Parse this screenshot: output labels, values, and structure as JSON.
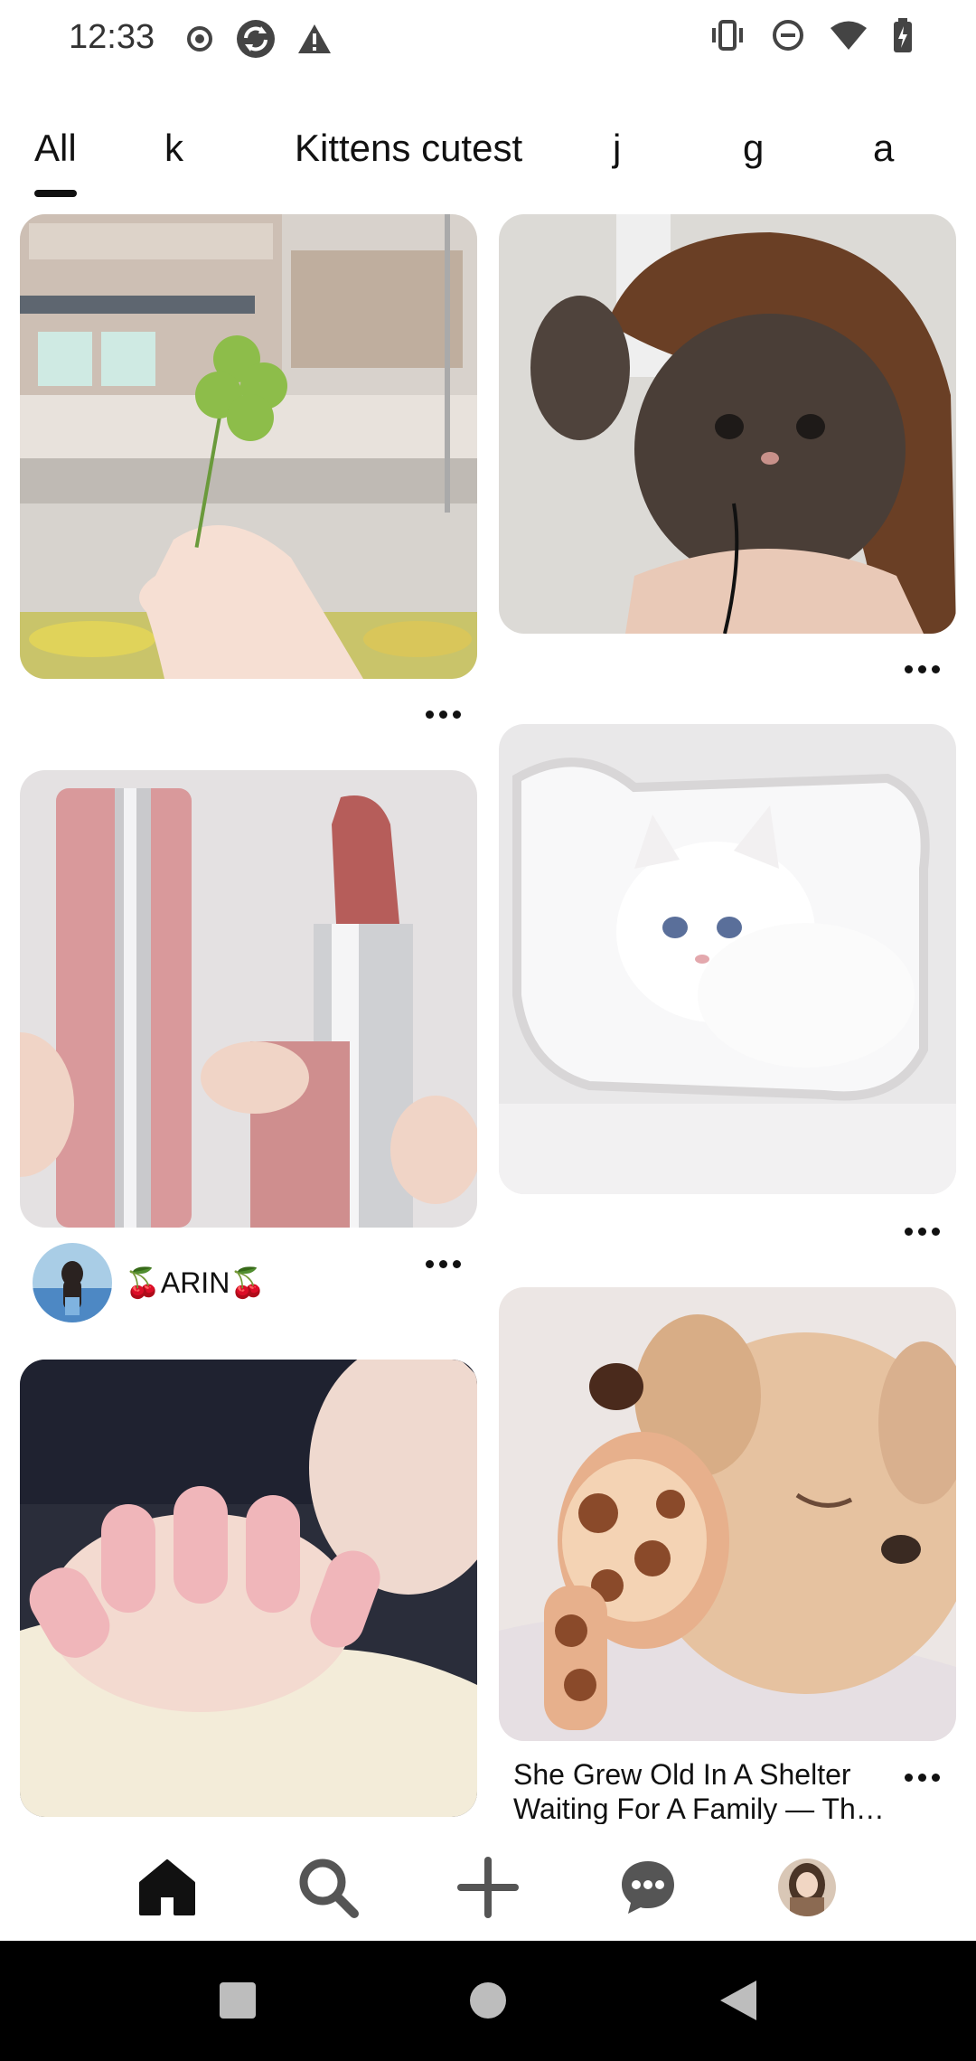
{
  "status_bar": {
    "time": "12:33",
    "left_icons": [
      "record-icon",
      "sync-icon",
      "warning-icon"
    ],
    "right_icons": [
      "vibrate-icon",
      "do-not-disturb-icon",
      "wifi-icon",
      "battery-charging-icon"
    ]
  },
  "tabs": [
    {
      "label": "All",
      "active": true
    },
    {
      "label": "k",
      "active": false
    },
    {
      "label": "Kittens cutest",
      "active": false
    },
    {
      "label": "j",
      "active": false
    },
    {
      "label": "g",
      "active": false
    },
    {
      "label": "a",
      "active": false
    }
  ],
  "pins": {
    "clover": {
      "image": "hand-holding-four-leaf-clover-illustration"
    },
    "kitten_hat": {
      "image": "brown-kitten-in-hood"
    },
    "lipstick": {
      "image": "pink-lipstick-givenchy"
    },
    "white_cat": {
      "image": "white-persian-kitten-in-shelf"
    },
    "nails": {
      "image": "pink-manicured-nails"
    },
    "puppy": {
      "image": "golden-puppy-sleeping-with-giraffe-toy",
      "title": "She Grew Old In A Shelter Waiting For A Family — Th…"
    }
  },
  "creator": {
    "name": "🍒ARIN🍒"
  },
  "bottom_nav": {
    "items": [
      "home-icon",
      "search-icon",
      "create-icon",
      "messages-icon",
      "profile-avatar"
    ]
  },
  "system_nav": {
    "items": [
      "recents-icon",
      "home-icon",
      "back-icon"
    ]
  },
  "colors": {
    "text": "#111111",
    "background": "#ffffff",
    "system_nav": "#000000"
  }
}
